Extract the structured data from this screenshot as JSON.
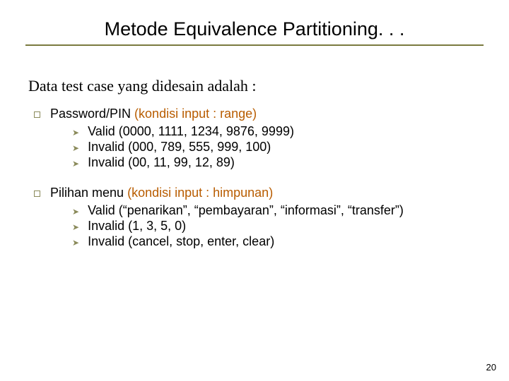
{
  "title": "Metode Equivalence Partitioning. . .",
  "intro": "Data test case yang didesain adalah :",
  "blocks": [
    {
      "heading_plain": "Password/PIN ",
      "heading_paren": "(kondisi input : range)",
      "items": [
        "Valid (0000, 1111, 1234, 9876, 9999)",
        "Invalid (000, 789, 555, 999, 100)",
        "Invalid (00, 11, 99, 12, 89)"
      ]
    },
    {
      "heading_plain": "Pilihan menu ",
      "heading_paren": "(kondisi input : himpunan)",
      "items": [
        "Valid (“penarikan”, “pembayaran”, “informasi”, “transfer”)",
        "Invalid (1, 3, 5, 0)",
        "Invalid (cancel, stop, enter, clear)"
      ]
    }
  ],
  "page_number": "20"
}
